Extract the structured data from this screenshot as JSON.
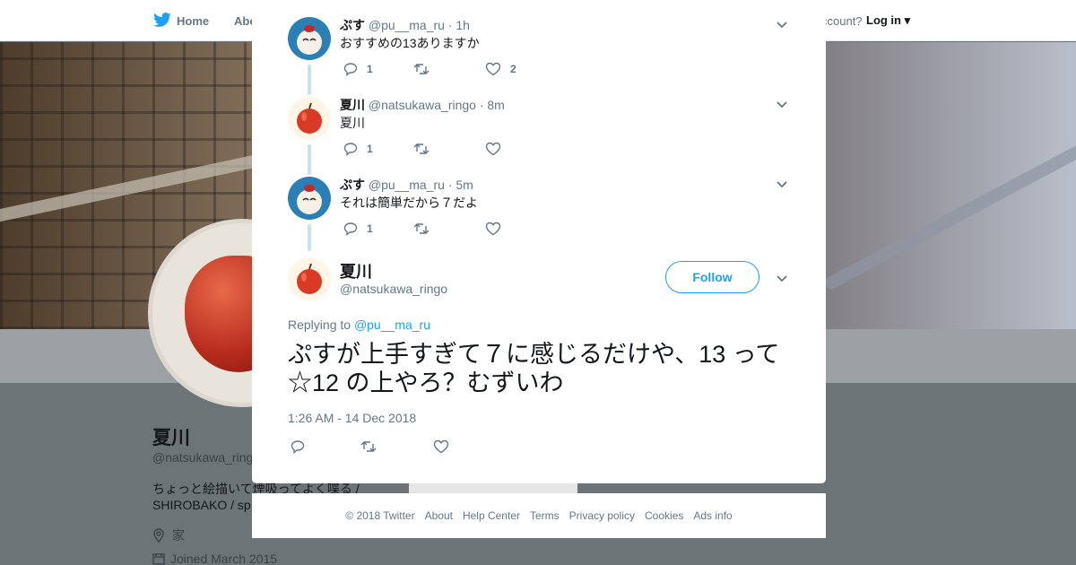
{
  "nav": {
    "home_label": "Home",
    "about_label": "Abo",
    "account_prompt": "ccount?",
    "login_label": "Log in"
  },
  "profile": {
    "name": "夏川",
    "handle": "@natsukawa_ringo",
    "bio_line1": "ちょっと絵描いて煙吸ってよく喋る /",
    "bio_line2": "SHIROBAKO / sp",
    "location": "家",
    "joined": "Joined March 2015",
    "ads_info_partial": "Ads info"
  },
  "thread": [
    {
      "name": "ぷす",
      "handle": "@pu__ma_ru",
      "time": "· 1h",
      "text": "おすすめの13ありますか",
      "replies": "1",
      "retweets": "",
      "likes": "2",
      "avatar": "blue-character"
    },
    {
      "name": "夏川",
      "handle": "@natsukawa_ringo",
      "time": "· 8m",
      "text": "夏川",
      "replies": "1",
      "retweets": "",
      "likes": "",
      "avatar": "apple"
    },
    {
      "name": "ぷす",
      "handle": "@pu__ma_ru",
      "time": "· 5m",
      "text": "それは簡単だから７だよ",
      "replies": "1",
      "retweets": "",
      "likes": "",
      "avatar": "blue-character"
    }
  ],
  "main_tweet": {
    "name": "夏川",
    "handle": "@natsukawa_ringo",
    "follow_label": "Follow",
    "replying_prefix": "Replying to",
    "replying_handle": "@pu__ma_ru",
    "text": "ぷすが上手すぎて７に感じるだけや、13 って☆12 の上やろ？むずいわ",
    "timestamp": "1:26 AM - 14 Dec 2018"
  },
  "footer": {
    "items": [
      "© 2018 Twitter",
      "About",
      "Help Center",
      "Terms",
      "Privacy policy",
      "Cookies",
      "Ads info"
    ]
  },
  "colors": {
    "accent": "#1da1f2",
    "secondary_text": "#657786",
    "thread_line": "#c4e4ed",
    "overlay": "#6b7276"
  }
}
